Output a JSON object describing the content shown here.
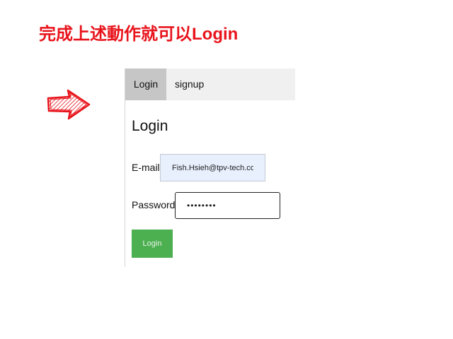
{
  "headline": "完成上述動作就可以Login",
  "arrow_icon": "hand-drawn-right-arrow",
  "accent_color": "#e8141c",
  "panel": {
    "tabs": [
      {
        "label": "Login",
        "active": true
      },
      {
        "label": "signup",
        "active": false
      }
    ],
    "form_title": "Login",
    "email": {
      "label": "E-mail",
      "value": "Fish.Hsieh@tpv-tech.com"
    },
    "password": {
      "label": "Password",
      "value": "••••••••"
    },
    "submit_label": "Login",
    "submit_color": "#4caf50"
  }
}
